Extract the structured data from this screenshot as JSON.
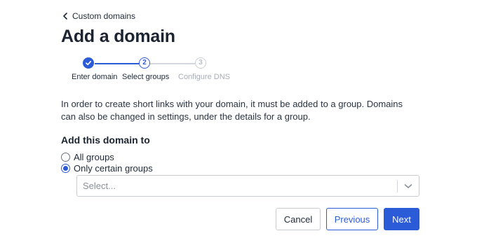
{
  "breadcrumb": {
    "label": "Custom domains"
  },
  "page_title": "Add a domain",
  "stepper": {
    "steps": [
      {
        "number": "1",
        "label": "Enter domain",
        "state": "done"
      },
      {
        "number": "2",
        "label": "Select groups",
        "state": "current"
      },
      {
        "number": "3",
        "label": "Configure DNS",
        "state": "todo"
      }
    ]
  },
  "intro_text": "In order to create short links with your domain, it must be added to a group. Domains can also be changed in settings, under the details for a group.",
  "section": {
    "title": "Add this domain to",
    "options": [
      {
        "label": "All groups",
        "checked": false
      },
      {
        "label": "Only certain groups",
        "checked": true
      }
    ]
  },
  "select": {
    "placeholder": "Select..."
  },
  "buttons": {
    "cancel": "Cancel",
    "previous": "Previous",
    "next": "Next"
  },
  "colors": {
    "accent": "#2b5bd7",
    "inactive": "#c9ced6",
    "text": "#1f2937"
  },
  "icons": {
    "breadcrumb": "chevron-left-icon",
    "step_done": "check-icon",
    "select": "chevron-down-icon"
  }
}
